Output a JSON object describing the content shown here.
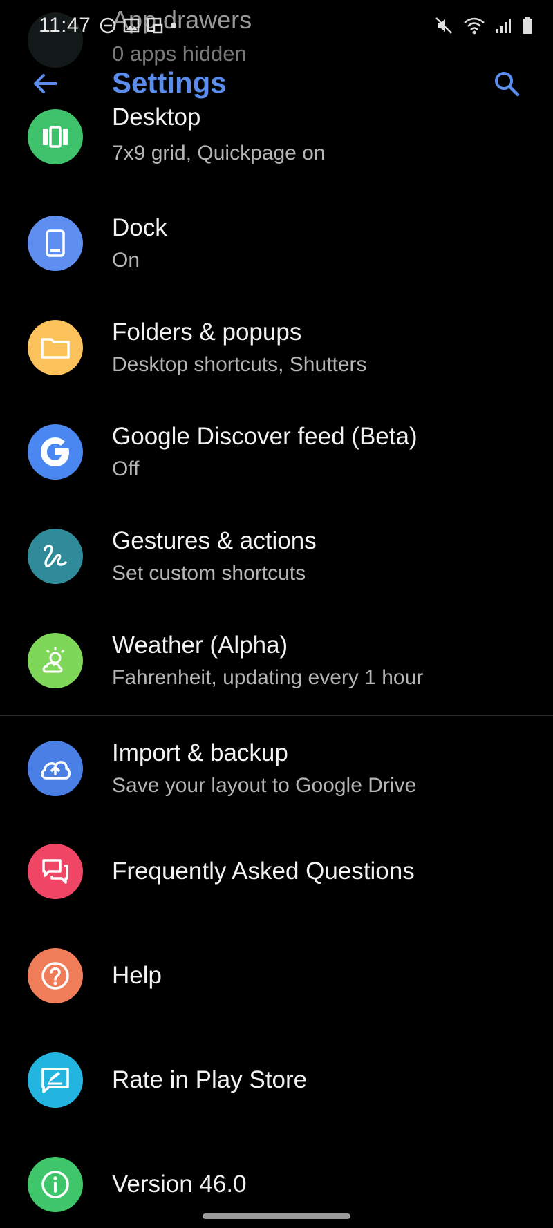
{
  "status_bar": {
    "time": "11:47"
  },
  "ghost": {
    "title": "App drawers",
    "subtitle": "0 apps hidden"
  },
  "app_bar": {
    "title": "Settings"
  },
  "items": [
    {
      "title": "Desktop",
      "subtitle": "7x9 grid, Quickpage on",
      "icon": "desktop-icon",
      "color": "#3ec26b"
    },
    {
      "title": "Dock",
      "subtitle": "On",
      "icon": "dock-icon",
      "color": "#5e8ef0"
    },
    {
      "title": "Folders & popups",
      "subtitle": "Desktop shortcuts, Shutters",
      "icon": "folder-icon",
      "color": "#fbc25b"
    },
    {
      "title": "Google Discover feed (Beta)",
      "subtitle": "Off",
      "icon": "google-icon",
      "color": "#4a87f0"
    },
    {
      "title": "Gestures & actions",
      "subtitle": "Set custom shortcuts",
      "icon": "gesture-icon",
      "color": "#2f8b9a"
    },
    {
      "title": "Weather (Alpha)",
      "subtitle": "Fahrenheit, updating every 1 hour",
      "icon": "weather-icon",
      "color": "#7fd75a"
    },
    {
      "title": "Import & backup",
      "subtitle": "Save your layout to Google Drive",
      "icon": "cloud-upload-icon",
      "color": "#4a7fe6"
    },
    {
      "title": "Frequently Asked Questions",
      "subtitle": "",
      "icon": "faq-icon",
      "color": "#ee4664"
    },
    {
      "title": "Help",
      "subtitle": "",
      "icon": "help-icon",
      "color": "#f07d5a"
    },
    {
      "title": "Rate in Play Store",
      "subtitle": "",
      "icon": "rate-icon",
      "color": "#23b5e0"
    },
    {
      "title": "Version 46.0",
      "subtitle": "",
      "icon": "info-icon",
      "color": "#3fc56a"
    }
  ]
}
